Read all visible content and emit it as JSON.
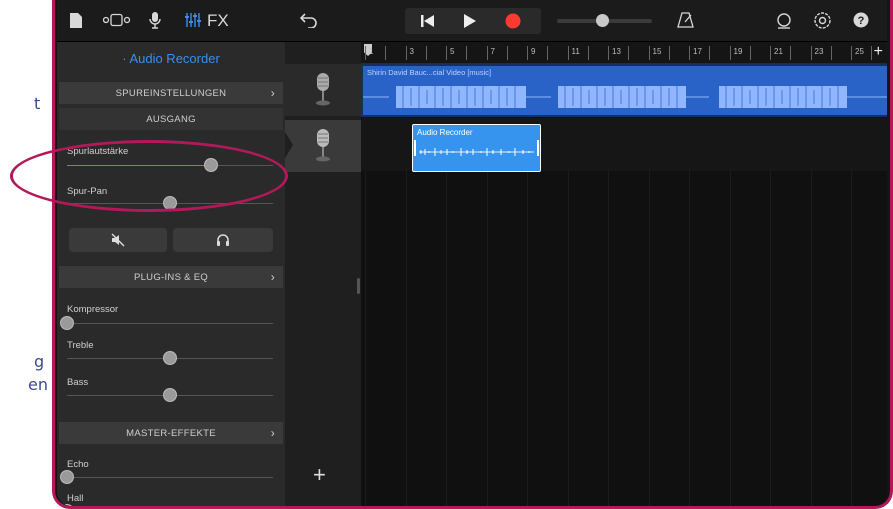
{
  "background_fragments": [
    "t",
    "g",
    "en"
  ],
  "toolbar": {
    "fx_label": "FX",
    "icons": [
      "my-songs-icon",
      "track-view-icon",
      "mic-icon",
      "mixer-icon",
      "undo-icon",
      "rewind-icon",
      "play-icon",
      "record-icon",
      "metronome-icon",
      "loop-icon",
      "settings-icon",
      "help-icon"
    ],
    "record_color": "#ff3b30",
    "accent_color": "#3b8ef0"
  },
  "panel": {
    "title": "· Audio Recorder",
    "sections": {
      "track_settings": "SPUREINSTELLUNGEN",
      "output": "AUSGANG",
      "plugins": "PLUG-INS & EQ",
      "master": "MASTER-EFFEKTE"
    },
    "output_controls": [
      {
        "label": "Spurlautstärke",
        "level": 0.7
      },
      {
        "label": "Spur-Pan",
        "level": 0.5
      }
    ],
    "plugin_controls": [
      {
        "label": "Kompressor",
        "level": 0.0
      },
      {
        "label": "Treble",
        "level": 0.5
      },
      {
        "label": "Bass",
        "level": 0.5
      }
    ],
    "master_controls": [
      {
        "label": "Echo",
        "level": 0.0
      },
      {
        "label": "Hall",
        "level": 0.0
      }
    ]
  },
  "ruler": {
    "numbers": [
      "1",
      "3",
      "5",
      "7",
      "9",
      "11",
      "13",
      "15",
      "17",
      "19",
      "21",
      "23",
      "25"
    ]
  },
  "regions": {
    "track1": "Shirin David Bauc...cial Video [music]",
    "track2": "Audio Recorder"
  },
  "add_track_label": "+",
  "highlight_color": "#b3185a"
}
